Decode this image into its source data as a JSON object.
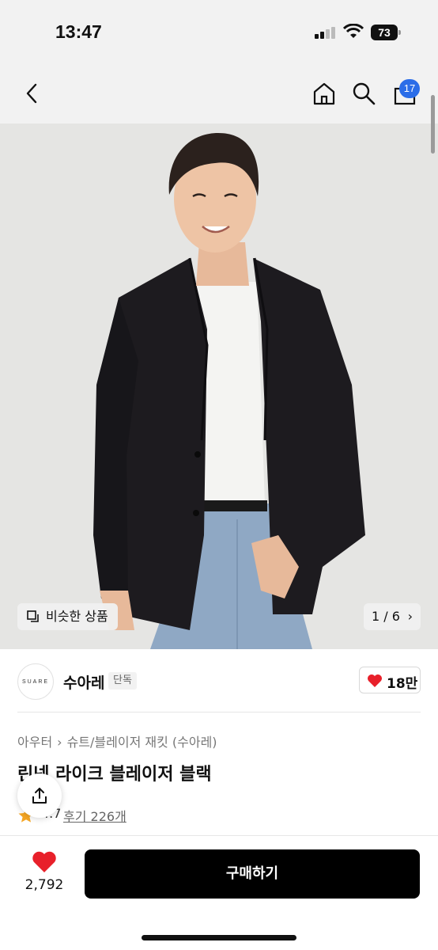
{
  "status_bar": {
    "time": "13:47",
    "battery": "73"
  },
  "nav": {
    "back_icon": "chevron-left-icon",
    "home_icon": "home-icon",
    "search_icon": "search-icon",
    "cart_icon": "shopping-bag-icon",
    "cart_badge": "17"
  },
  "gallery": {
    "similar_label": "비슷한 상품",
    "pager": "1 / 6"
  },
  "brand": {
    "logo_text": "SUARE",
    "name": "수아레",
    "tag": "단독",
    "likes": "18만"
  },
  "product": {
    "breadcrumb": [
      "아우터",
      "슈트/블레이저 재킷 (수아레)"
    ],
    "title": "린넨 라이크 블레이저 블랙",
    "rating": "4.7",
    "reviews": "후기 226개"
  },
  "actions": {
    "wish_count": "2,792",
    "buy_label": "구매하기"
  },
  "colors": {
    "accent_blue": "#2b6de8",
    "heart_red": "#e8202a",
    "star_orange": "#f5a623",
    "buy_black": "#000000"
  }
}
